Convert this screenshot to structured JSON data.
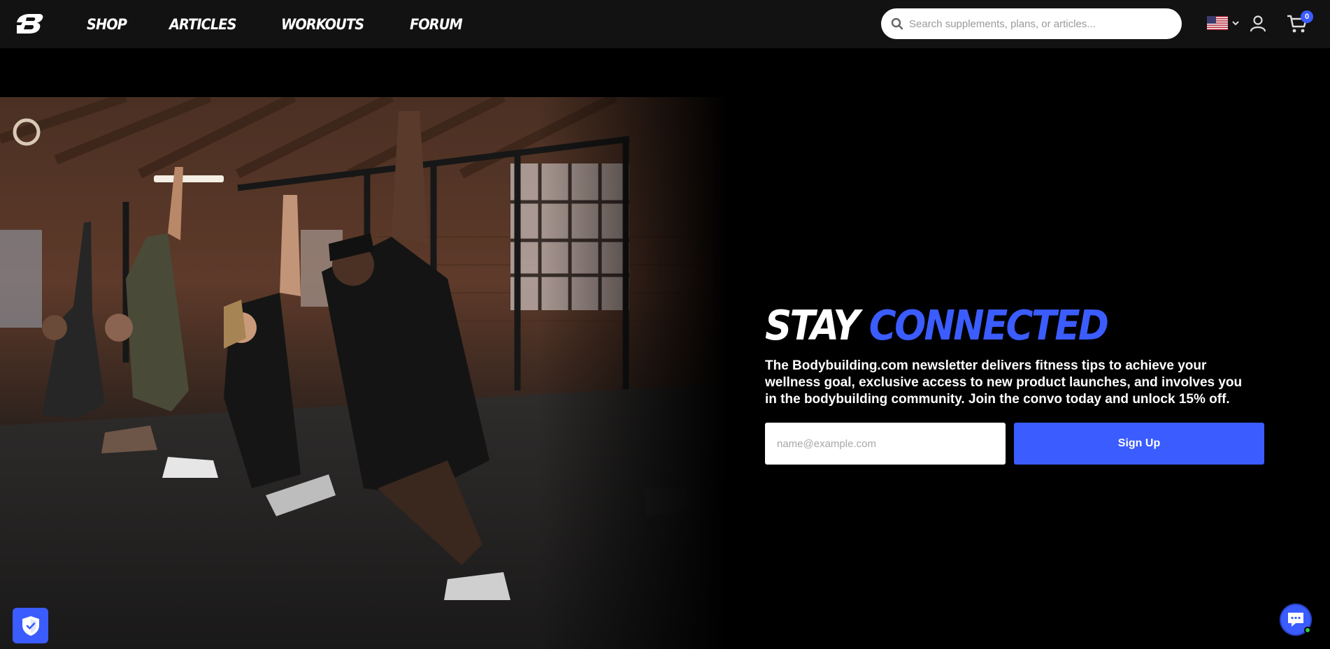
{
  "header": {
    "logo_icon": "bodybuilding-b-logo-icon",
    "nav": [
      {
        "label": "SHOP"
      },
      {
        "label": "ARTICLES"
      },
      {
        "label": "WORKOUTS"
      },
      {
        "label": "FORUM"
      }
    ],
    "search": {
      "placeholder": "Search supplements, plans, or articles...",
      "value": "",
      "icon": "search-icon"
    },
    "country_icon": "us-flag-icon",
    "cart_count": "0"
  },
  "hero": {
    "image": "group-stretching-in-gym-photo"
  },
  "newsletter": {
    "headline_white": "STAY",
    "headline_blue": "CONNECTED",
    "description": "The Bodybuilding.com newsletter delivers fitness tips to achieve your wellness goal, exclusive access to new product launches, and involves you in the bodybuilding community. Join the convo today and unlock 15% off.",
    "email_placeholder": "name@example.com",
    "email_value": "",
    "button_label": "Sign Up"
  },
  "widgets": {
    "privacy_icon": "shield-check-icon",
    "chat_icon": "chat-bubble-icon"
  },
  "colors": {
    "accent": "#3b5cff",
    "header_bg": "#121212",
    "page_bg": "#000000"
  }
}
